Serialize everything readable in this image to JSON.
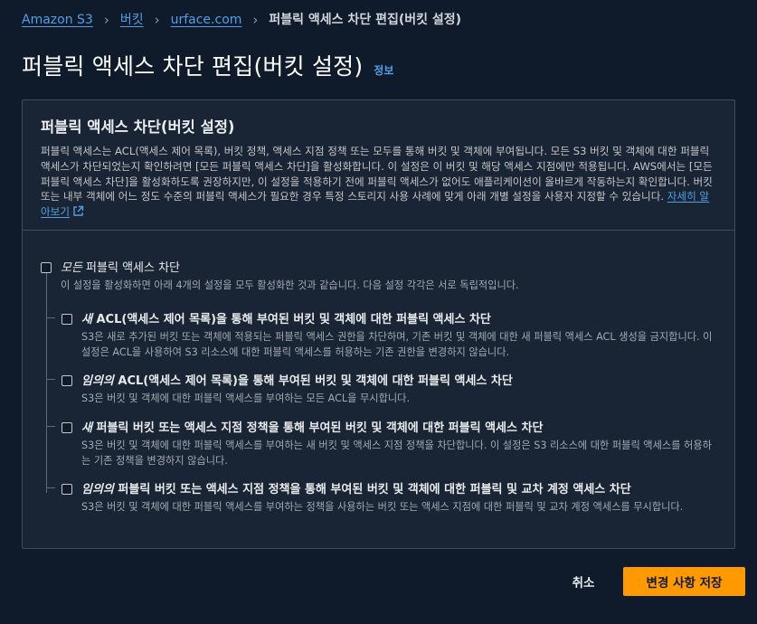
{
  "breadcrumb": {
    "items": [
      "Amazon S3",
      "버킷",
      "urface.com"
    ],
    "current": "퍼블릭 액세스 차단 편집(버킷 설정)"
  },
  "page": {
    "title": "퍼블릭 액세스 차단 편집(버킷 설정)",
    "info_link": "정보"
  },
  "panel": {
    "title": "퍼블릭 액세스 차단(버킷 설정)",
    "description": "퍼블릭 액세스는 ACL(액세스 제어 목록), 버킷 정책, 액세스 지점 정책 또는 모두를 통해 버킷 및 객체에 부여됩니다. 모든 S3 버킷 및 객체에 대한 퍼블릭 액세스가 차단되었는지 확인하려면 [모든 퍼블릭 액세스 차단]을 활성화합니다. 이 설정은 이 버킷 및 해당 액세스 지점에만 적용됩니다. AWS에서는 [모든 퍼블릭 액세스 차단]을 활성화하도록 권장하지만, 이 설정을 적용하기 전에 퍼블릭 액세스가 없어도 애플리케이션이 올바르게 작동하는지 확인합니다. 버킷 또는 내부 객체에 어느 정도 수준의 퍼블릭 액세스가 필요한 경우 특정 스토리지 사용 사례에 맞게 아래 개별 설정을 사용자 지정할 수 있습니다.",
    "learn_more": "자세히 알아보기"
  },
  "options": {
    "all": {
      "label_em": "모든",
      "label_rest": " 퍼블릭 액세스 차단",
      "desc": "이 설정을 활성화하면 아래 4개의 설정을 모두 활성화한 것과 같습니다. 다음 설정 각각은 서로 독립적입니다.",
      "checked": false
    },
    "items": [
      {
        "label_em": "새",
        "label_rest": " ACL(액세스 제어 목록)을 통해 부여된 버킷 및 객체에 대한 퍼블릭 액세스 차단",
        "desc": "S3은 새로 추가된 버킷 또는 객체에 적용되는 퍼블릭 액세스 권한을 차단하며, 기존 버킷 및 객체에 대한 새 퍼블릭 액세스 ACL 생성을 금지합니다. 이 설정은 ACL을 사용하여 S3 리소스에 대한 퍼블릭 액세스를 허용하는 기존 권한을 변경하지 않습니다.",
        "checked": false
      },
      {
        "label_em": "임의의",
        "label_rest": " ACL(액세스 제어 목록)을 통해 부여된 버킷 및 객체에 대한 퍼블릭 액세스 차단",
        "desc": "S3은 버킷 및 객체에 대한 퍼블릭 액세스를 부여하는 모든 ACL을 무시합니다.",
        "checked": false
      },
      {
        "label_em": "새",
        "label_rest": " 퍼블릭 버킷 또는 액세스 지점 정책을 통해 부여된 버킷 및 객체에 대한 퍼블릭 액세스 차단",
        "desc": "S3은 버킷 및 객체에 대한 퍼블릭 액세스를 부여하는 새 버킷 및 액세스 지점 정책을 차단합니다. 이 설정은 S3 리소스에 대한 퍼블릭 액세스를 허용하는 기존 정책을 변경하지 않습니다.",
        "checked": false
      },
      {
        "label_em": "임의의",
        "label_rest": " 퍼블릭 버킷 또는 액세스 지점 정책을 통해 부여된 버킷 및 객체에 대한 퍼블릭 및 교차 계정 액세스 차단",
        "desc": "S3은 버킷 및 객체에 대한 퍼블릭 액세스를 부여하는 정책을 사용하는 버킷 또는 액세스 지점에 대한 퍼블릭 및 교차 계정 액세스를 무시합니다.",
        "checked": false
      }
    ]
  },
  "actions": {
    "cancel": "취소",
    "save": "변경 사항 저장"
  },
  "colors": {
    "background": "#0f1b2a",
    "panel": "#192534",
    "link": "#539fe5",
    "primary_button": "#ff9900"
  },
  "icons": [
    "chevron-right-icon",
    "external-link-icon",
    "checkbox-icon"
  ]
}
